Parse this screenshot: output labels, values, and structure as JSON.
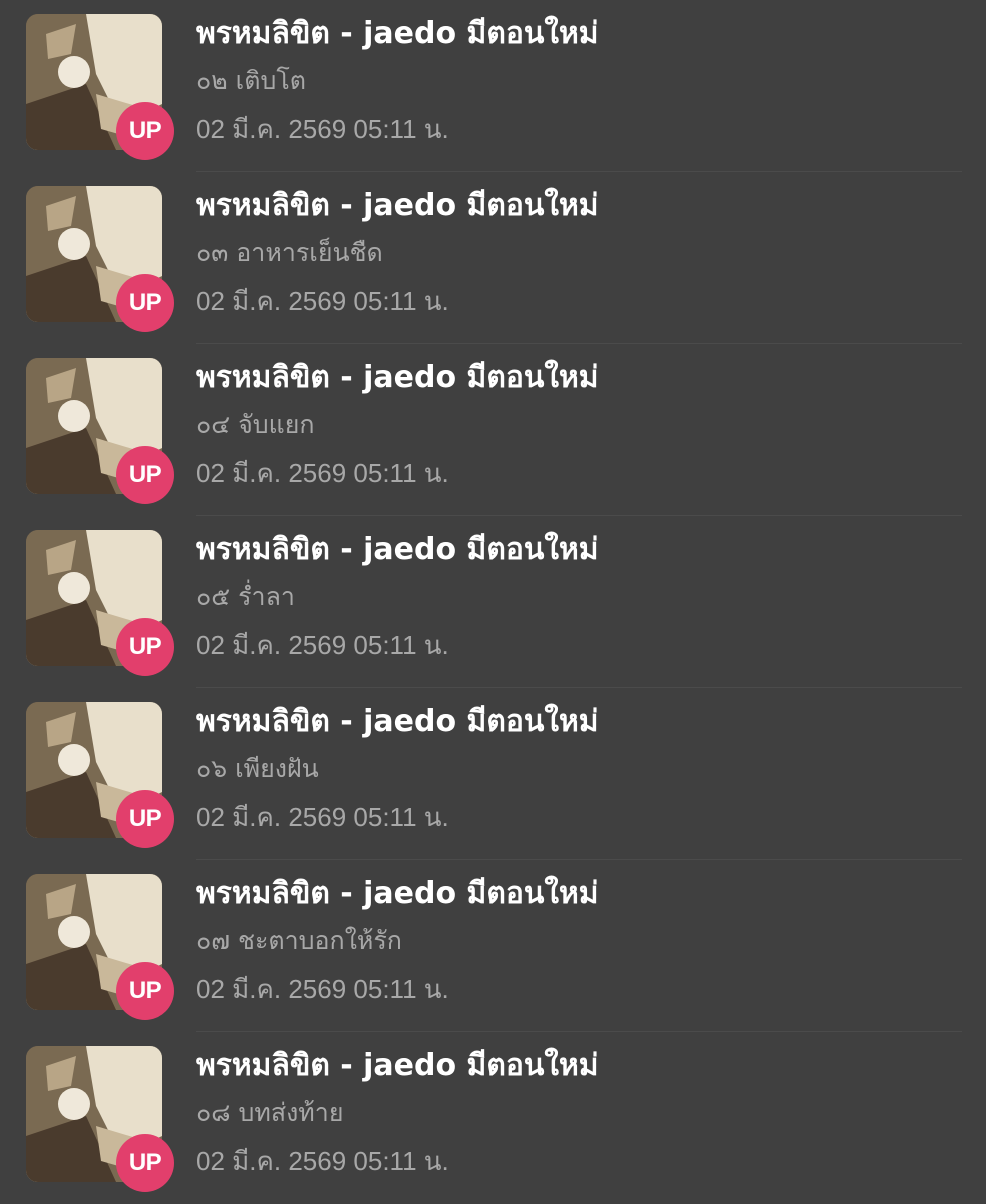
{
  "notifications": [
    {
      "title": "พรหมลิขิต - jaedo มีตอนใหม่",
      "subtitle": "๐๒ เติบโต",
      "date": "02 มี.ค. 2569 05:11 น.",
      "badge": "UP"
    },
    {
      "title": "พรหมลิขิต - jaedo มีตอนใหม่",
      "subtitle": "๐๓ อาหารเย็นชืด",
      "date": "02 มี.ค. 2569 05:11 น.",
      "badge": "UP"
    },
    {
      "title": "พรหมลิขิต - jaedo มีตอนใหม่",
      "subtitle": "๐๔ จับแยก",
      "date": "02 มี.ค. 2569 05:11 น.",
      "badge": "UP"
    },
    {
      "title": "พรหมลิขิต - jaedo มีตอนใหม่",
      "subtitle": "๐๕ ร่ำลา",
      "date": "02 มี.ค. 2569 05:11 น.",
      "badge": "UP"
    },
    {
      "title": "พรหมลิขิต - jaedo มีตอนใหม่",
      "subtitle": "๐๖ เพียงฝัน",
      "date": "02 มี.ค. 2569 05:11 น.",
      "badge": "UP"
    },
    {
      "title": "พรหมลิขิต - jaedo มีตอนใหม่",
      "subtitle": "๐๗ ชะตาบอกให้รัก",
      "date": "02 มี.ค. 2569 05:11 น.",
      "badge": "UP"
    },
    {
      "title": "พรหมลิขิต - jaedo มีตอนใหม่",
      "subtitle": "๐๘ บทส่งท้าย",
      "date": "02 มี.ค. 2569 05:11 น.",
      "badge": "UP"
    }
  ],
  "colors": {
    "background": "#404040",
    "badge": "#e23f6c",
    "title": "#ffffff",
    "secondary_text": "#a8a8a8"
  },
  "icons": {
    "thumbnail": "story-cover-thumbnail",
    "badge": "update-badge"
  }
}
